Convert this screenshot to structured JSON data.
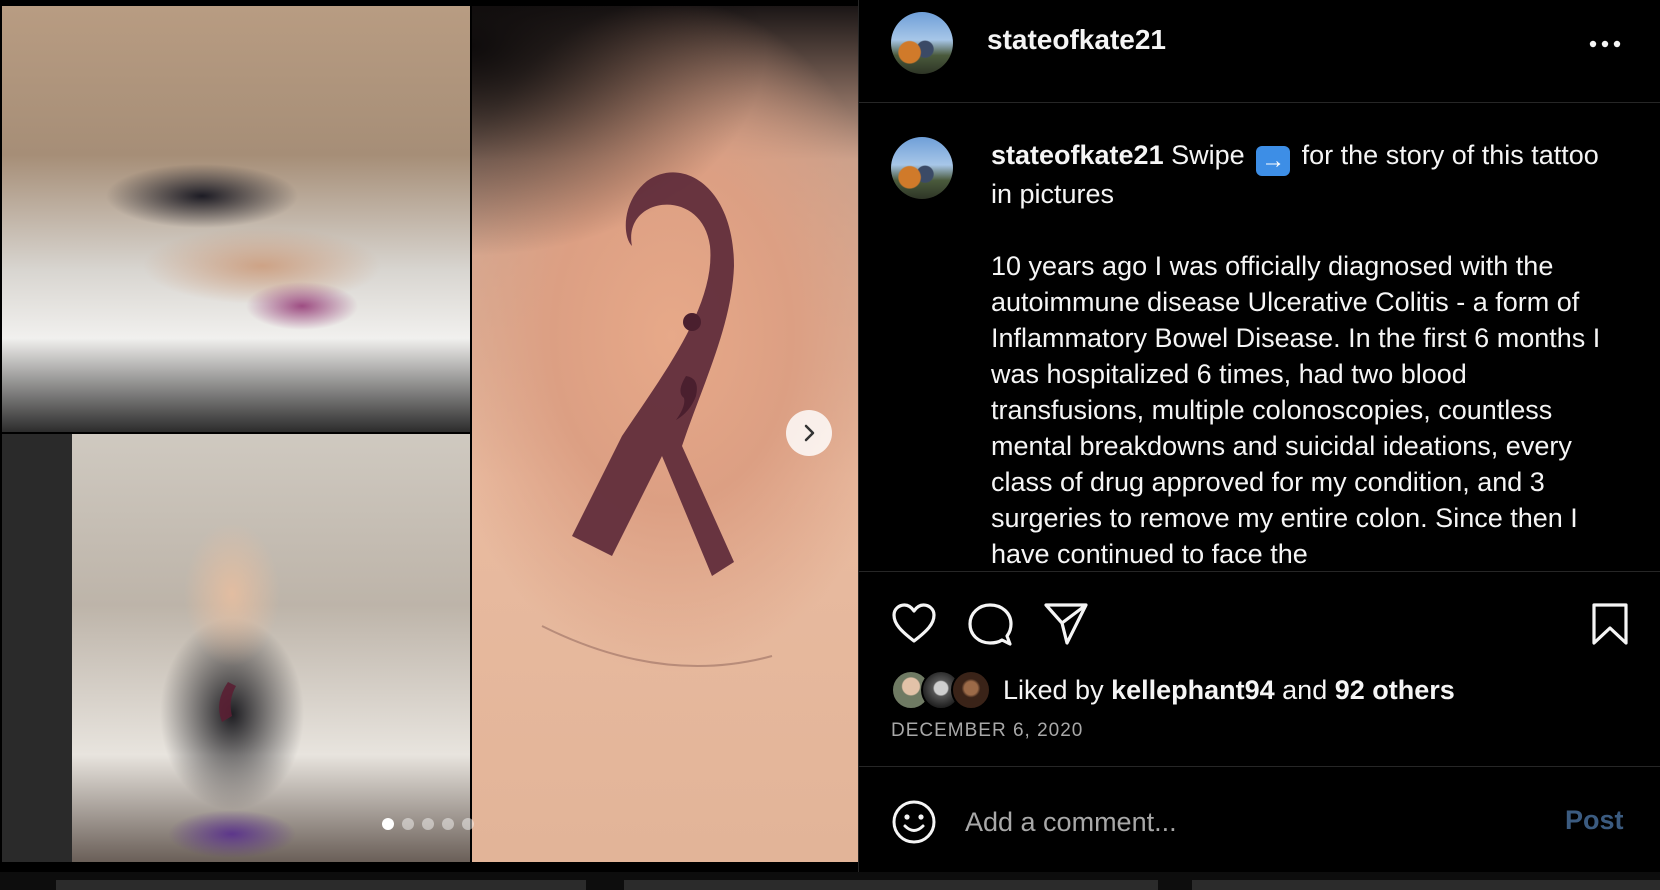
{
  "post": {
    "username": "stateofkate21",
    "more_icon": "more-horizontal-icon",
    "caption": {
      "username": "stateofkate21",
      "intro_before": " Swipe ",
      "swipe_emoji": "➡️",
      "intro_after": " for the story of this tattoo in pictures",
      "body": "10 years ago I was officially diagnosed with the autoimmune disease Ulcerative Colitis - a form of Inflammatory Bowel Disease. In the first 6 months I was hospitalized 6 times, had two blood transfusions, multiple colonoscopies, countless mental breakdowns and suicidal ideations, every class of drug approved for my condition, and 3 surgeries to remove my entire colon. Since then I have continued to face the"
    },
    "actions": {
      "like_icon": "heart-icon",
      "comment_icon": "comment-icon",
      "share_icon": "send-icon",
      "save_icon": "bookmark-icon"
    },
    "likes": {
      "prefix": "Liked by ",
      "user": "kellephant94",
      "middle": " and ",
      "others": "92 others"
    },
    "date": "DECEMBER 6, 2020",
    "comment": {
      "placeholder": "Add a comment...",
      "post_label": "Post",
      "emoji_icon": "smiley-icon"
    },
    "carousel": {
      "total_slides": 5,
      "active_slide": 1
    },
    "colors": {
      "background": "#000000",
      "text": "#f5f5f5",
      "muted": "#a8a8a8",
      "post_button_disabled": "#3b5b80",
      "divider": "#262626"
    }
  }
}
